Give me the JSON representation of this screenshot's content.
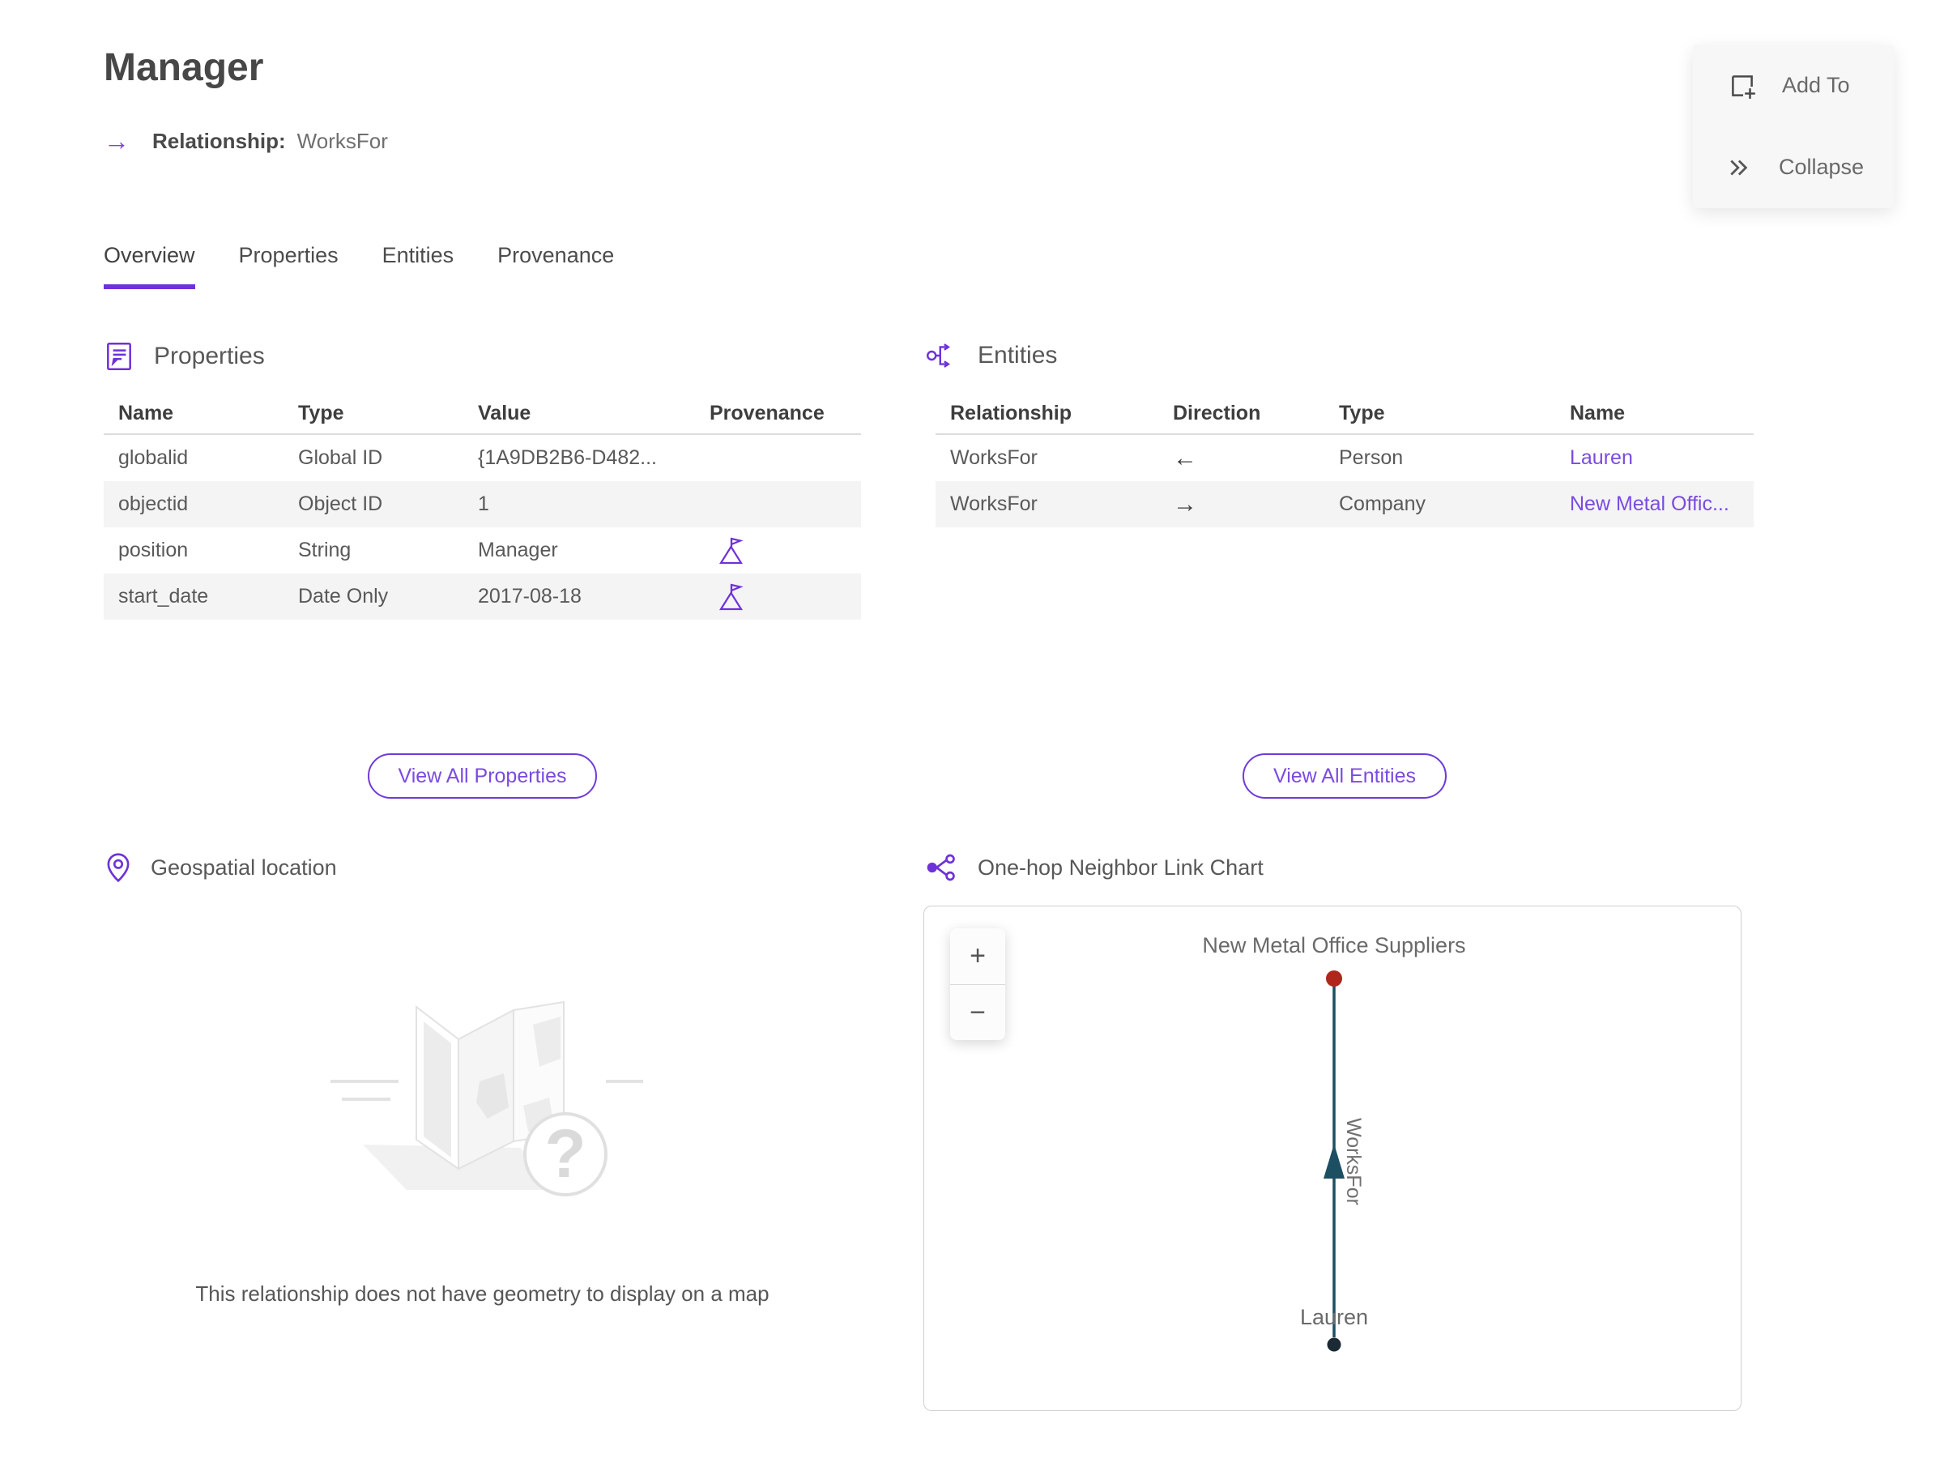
{
  "header": {
    "title": "Manager",
    "arrow_glyph": "→",
    "subtitle_label": "Relationship:",
    "subtitle_value": "WorksFor"
  },
  "actions": {
    "add_to": "Add To",
    "collapse": "Collapse"
  },
  "tabs": [
    {
      "label": "Overview",
      "active": true
    },
    {
      "label": "Properties",
      "active": false
    },
    {
      "label": "Entities",
      "active": false
    },
    {
      "label": "Provenance",
      "active": false
    }
  ],
  "properties_section": {
    "title": "Properties",
    "columns": [
      "Name",
      "Type",
      "Value",
      "Provenance"
    ],
    "rows": [
      {
        "name": "globalid",
        "type": "Global ID",
        "value": "{1A9DB2B6-D482...",
        "has_provenance": false
      },
      {
        "name": "objectid",
        "type": "Object ID",
        "value": "1",
        "has_provenance": false
      },
      {
        "name": "position",
        "type": "String",
        "value": "Manager",
        "has_provenance": true
      },
      {
        "name": "start_date",
        "type": "Date Only",
        "value": "2017-08-18",
        "has_provenance": true
      }
    ],
    "view_all": "View All Properties"
  },
  "entities_section": {
    "title": "Entities",
    "columns": [
      "Relationship",
      "Direction",
      "Type",
      "Name"
    ],
    "rows": [
      {
        "relationship": "WorksFor",
        "direction": "←",
        "type": "Person",
        "name": "Lauren"
      },
      {
        "relationship": "WorksFor",
        "direction": "→",
        "type": "Company",
        "name": "New Metal Offic..."
      }
    ],
    "view_all": "View All Entities"
  },
  "geospatial": {
    "title": "Geospatial location",
    "placeholder_glyph": "?",
    "empty_message": "This relationship does not have geometry to display on a map"
  },
  "link_chart": {
    "title": "One-hop Neighbor Link Chart",
    "zoom_in": "+",
    "zoom_out": "−",
    "nodes": [
      {
        "label": "New Metal Office Suppliers",
        "color": "#b0261c"
      },
      {
        "label": "Lauren",
        "color": "#1b2a33"
      }
    ],
    "edge_label": "WorksFor"
  },
  "icons": {
    "properties": "memo-icon",
    "entities": "link-entities-icon",
    "geospatial": "map-pin-icon",
    "link_chart": "one-hop-share-icon",
    "provenance": "flag-icon",
    "add_to": "add-to-selection-icon",
    "collapse": "double-chevron-right-icon"
  },
  "colors": {
    "accent_purple": "#6e32d9",
    "link_purple": "#7a4be0",
    "edge_teal": "#1d4f63",
    "node_red": "#b0261c",
    "node_dark": "#1b2a33",
    "row_alt_gray": "#f4f4f4"
  }
}
